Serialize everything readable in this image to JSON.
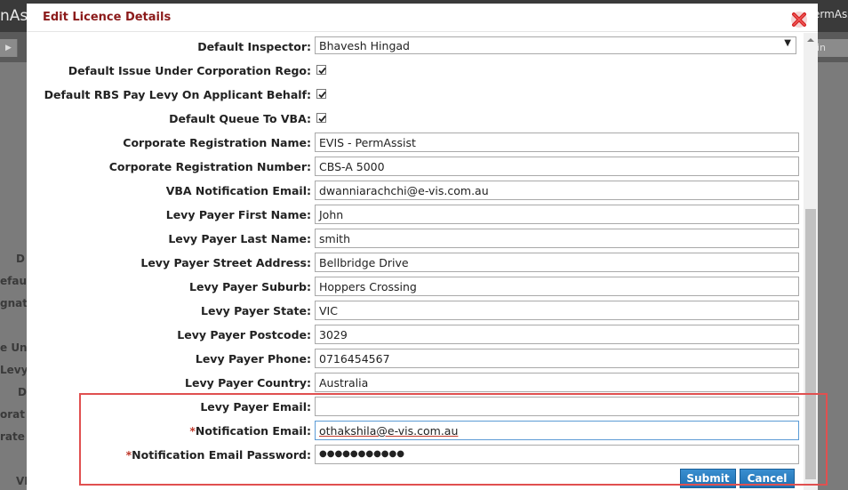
{
  "background": {
    "app_title_fragment": "nAss",
    "app_title_right_fragment": "ermAss",
    "nav_right_fragment": "in",
    "left_labels": [
      "D",
      "efau",
      "gnat",
      "e Und",
      "Levy",
      "D",
      "orat",
      "rate",
      "VI"
    ]
  },
  "modal": {
    "title": "Edit Licence Details",
    "close_icon": "close-icon"
  },
  "form": {
    "default_inspector": {
      "label": "Default Inspector:",
      "value": "Bhavesh Hingad"
    },
    "default_issue_corp_rego": {
      "label": "Default Issue Under Corporation Rego:",
      "checked": true
    },
    "default_rbs_pay_levy": {
      "label": "Default RBS Pay Levy On Applicant Behalf:",
      "checked": true
    },
    "default_queue_vba": {
      "label": "Default Queue To VBA:",
      "checked": true
    },
    "corp_reg_name": {
      "label": "Corporate Registration Name:",
      "value": "EVIS - PermAssist"
    },
    "corp_reg_number": {
      "label": "Corporate Registration Number:",
      "value": "CBS-A 5000"
    },
    "vba_notification_email": {
      "label": "VBA Notification Email:",
      "value": "dwanniarachchi@e-vis.com.au"
    },
    "levy_first_name": {
      "label": "Levy Payer First Name:",
      "value": "John"
    },
    "levy_last_name": {
      "label": "Levy Payer Last Name:",
      "value": "smith"
    },
    "levy_street": {
      "label": "Levy Payer Street Address:",
      "value": "Bellbridge Drive"
    },
    "levy_suburb": {
      "label": "Levy Payer Suburb:",
      "value": "Hoppers Crossing"
    },
    "levy_state": {
      "label": "Levy Payer State:",
      "value": "VIC"
    },
    "levy_postcode": {
      "label": "Levy Payer Postcode:",
      "value": "3029"
    },
    "levy_phone": {
      "label": "Levy Payer Phone:",
      "value": "0716454567"
    },
    "levy_country": {
      "label": "Levy Payer Country:",
      "value": "Australia"
    },
    "levy_email": {
      "label": "Levy Payer Email:",
      "value": ""
    },
    "notification_email": {
      "required_mark": "*",
      "label": "Notification Email:",
      "value": "othakshila@e-vis.com.au"
    },
    "notification_password": {
      "required_mark": "*",
      "label": "Notification Email Password:",
      "value": "●●●●●●●●●●●"
    }
  },
  "buttons": {
    "submit": "Submit",
    "cancel": "Cancel"
  },
  "colors": {
    "title_red": "#8b1a1a",
    "button_blue": "#1f6fb2",
    "highlight_red": "#e05050",
    "required_red": "#c0392b"
  }
}
